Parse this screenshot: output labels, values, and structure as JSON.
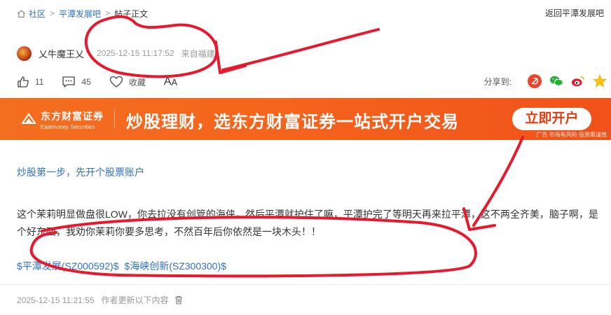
{
  "breadcrumb": {
    "items": [
      {
        "label": "社区",
        "link": true
      },
      {
        "label": "平潭发展吧",
        "link": true
      },
      {
        "label": "帖子正文",
        "link": false
      }
    ],
    "separator": ">",
    "back_label": "返回平潭发展吧"
  },
  "author": {
    "name": "乂牛魔王乂",
    "time": "2025-12-15 11:17:52",
    "source": "来自福建"
  },
  "actions": {
    "like_count": "11",
    "comment_count": "45",
    "favorite_label": "收藏",
    "font_toggle": "A",
    "font_toggle_small": "A"
  },
  "share": {
    "label": "分享到:",
    "icons": [
      "weibo-tencent-icon",
      "wechat-icon",
      "weibo-icon",
      "qzone-icon"
    ]
  },
  "ad": {
    "brand": "东方财富证券",
    "brand_en": "Eastmoney Securities",
    "slogan": "炒股理财，选东方财富证券一站式开户交易",
    "button": "立即开户",
    "tag": "广告 市场有风险 投资需谨慎"
  },
  "post": {
    "title": "炒股第一步，先开个股票账户",
    "body": "这个茉莉明显做盘很LOW，你去拉没有创管的海侠，然后平潭就护住了嘛，平潭护完了等明天再来拉平潭，这不两全齐美，脑子啊，是个好东西，我劝你茉莉你要多思考，不然百年后你依然是一块木头！！",
    "stock_tags": [
      "$平潭发展(SZ000592)$",
      "$海峡创新(SZ300300)$"
    ]
  },
  "edit": {
    "time": "2025-12-15 11:21:55",
    "note": "作者更新以下内容"
  },
  "colors": {
    "link_blue": "#2f6fc4",
    "banner_orange": "#f46e1f",
    "annotation_red": "#e8192c"
  }
}
